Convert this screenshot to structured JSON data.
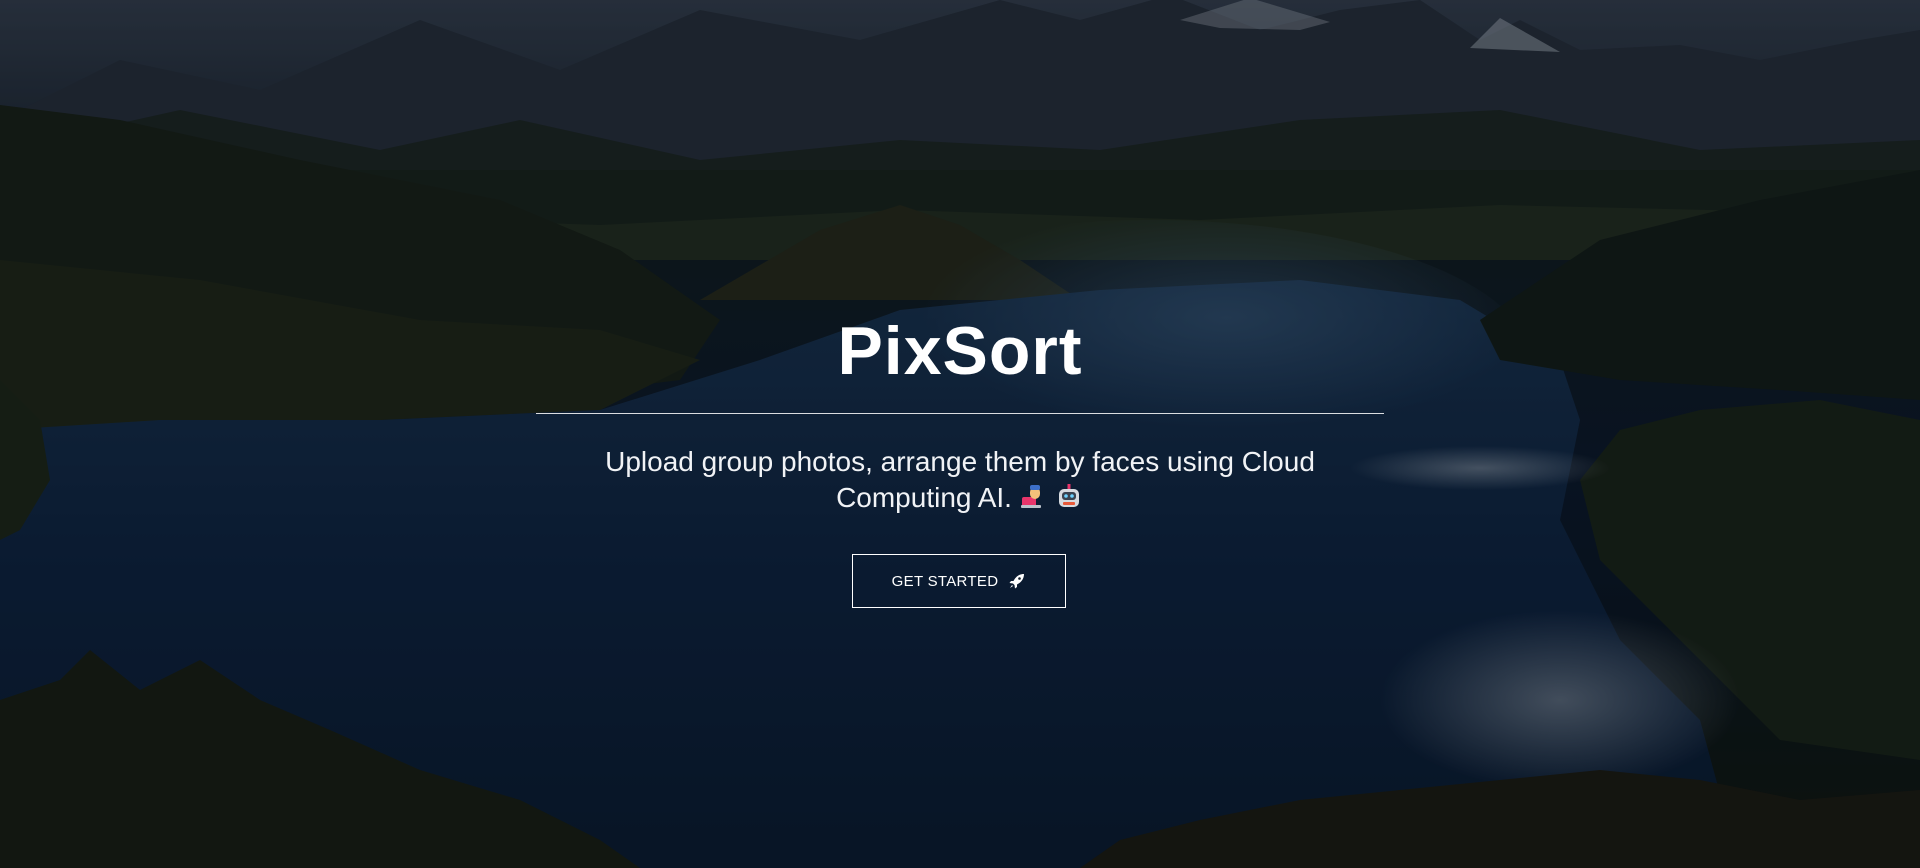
{
  "hero": {
    "title": "PixSort",
    "subtitle": "Upload group photos, arrange them by faces using Cloud Computing AI.",
    "subtitle_emojis": [
      "woman-technologist-icon",
      "robot-icon"
    ],
    "cta": {
      "label": "GET STARTED",
      "icon": "rocket-icon"
    },
    "background": "mountain-lake-landscape-photo"
  },
  "colors": {
    "text": "#ffffff",
    "overlay": "#050c18"
  }
}
